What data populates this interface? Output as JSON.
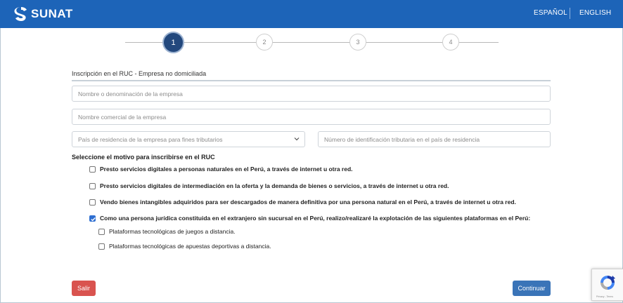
{
  "header": {
    "brand": "SUNAT",
    "lang_es": "ESPAÑOL",
    "lang_en": "ENGLISH",
    "colors": {
      "header_bg": "#1d64b8",
      "step_active": "#23487d"
    }
  },
  "stepper": {
    "steps": [
      "1",
      "2",
      "3",
      "4"
    ],
    "current": 1
  },
  "form": {
    "section_title": "Inscripción en el RUC - Empresa no domiciliada",
    "company_name_placeholder": "Nombre o denominación de la empresa",
    "trade_name_placeholder": "Nombre comercial de la empresa",
    "country_select_value": "País de residencia de la empresa para fines tributarios",
    "tax_id_placeholder": "Número de identificación tributaria en el país de residencia",
    "question": "Seleccione el motivo para inscribirse en el RUC",
    "options": [
      {
        "label": "Presto servicios digitales a personas naturales en el Perú, a través de internet u otra red.",
        "checked": false
      },
      {
        "label": "Presto servicios digitales de intermediación en la oferta y la demanda de bienes o servicios, a través de internet u otra red.",
        "checked": false
      },
      {
        "label": "Vendo bienes intangibles adquiridos para ser descargados de manera definitiva por una persona natural en el Perú, a través de internet u otra red.",
        "checked": false
      },
      {
        "label": "Como una persona jurídica constituida en el extranjero sin sucursal en el Perú, realizo/realizaré la explotación de las siguientes plataformas en el Perú:",
        "checked": true
      }
    ],
    "sub_options": [
      {
        "label": "Plataformas tecnológicas de juegos a distancia.",
        "checked": false
      },
      {
        "label": "Plataformas tecnológicas de apuestas deportivas a distancia.",
        "checked": false
      }
    ]
  },
  "buttons": {
    "exit": "Salir",
    "continue": "Continuar"
  },
  "captcha": {
    "icon": "recaptcha-icon",
    "text": "Privacy - Terms"
  }
}
